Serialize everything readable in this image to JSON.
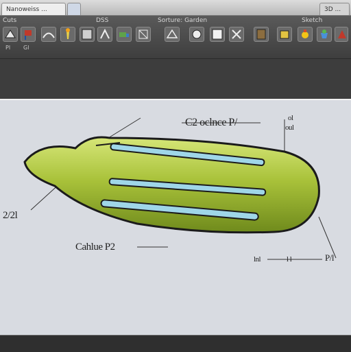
{
  "window": {
    "tab_active": "Nanoweiss ... ",
    "tab_secondary": "",
    "tab_right": "3D ..."
  },
  "toolbar": {
    "menu_items": [
      "Cuts",
      "DSS",
      "Sorture: Garden",
      "Sketch"
    ],
    "tools": [
      {
        "icon": "sketch-icon",
        "caption": "Pl"
      },
      {
        "icon": "flag-icon",
        "caption": "Gl"
      },
      {
        "icon": "bridge-icon",
        "caption": ""
      },
      {
        "icon": "torch-icon",
        "caption": ""
      },
      {
        "icon": "panel-icon",
        "caption": ""
      },
      {
        "icon": "shape-icon",
        "caption": ""
      },
      {
        "icon": "truck-icon",
        "caption": ""
      },
      {
        "icon": "cut-icon",
        "caption": ""
      },
      {
        "icon": "cube-icon",
        "caption": ""
      },
      {
        "icon": "sphere-icon",
        "caption": ""
      },
      {
        "icon": "grid-icon",
        "caption": ""
      },
      {
        "icon": "wedge-icon",
        "caption": ""
      },
      {
        "icon": "door-icon",
        "caption": ""
      },
      {
        "icon": "box-icon",
        "caption": ""
      },
      {
        "icon": "paint-icon",
        "caption": ""
      },
      {
        "icon": "pot-icon",
        "caption": ""
      },
      {
        "icon": "wizard-icon",
        "caption": ""
      }
    ]
  },
  "drawing": {
    "callout_top": "C2 oclnce P/",
    "callout_top_right_a": "ol",
    "callout_top_right_b": "oul",
    "callout_left": "2/2l",
    "callout_middle": "Cahlue P2",
    "callout_bottom_right_a": "lnl",
    "callout_bottom_right_b": "l l",
    "callout_bottom_right_c": "P/l"
  },
  "colors": {
    "body_fill": "#a9c23a",
    "body_highlight": "#d6e678",
    "body_shadow": "#6f8a1c",
    "groove_blue": "#9fd6e8",
    "canvas_bg": "#d8dbe1"
  }
}
